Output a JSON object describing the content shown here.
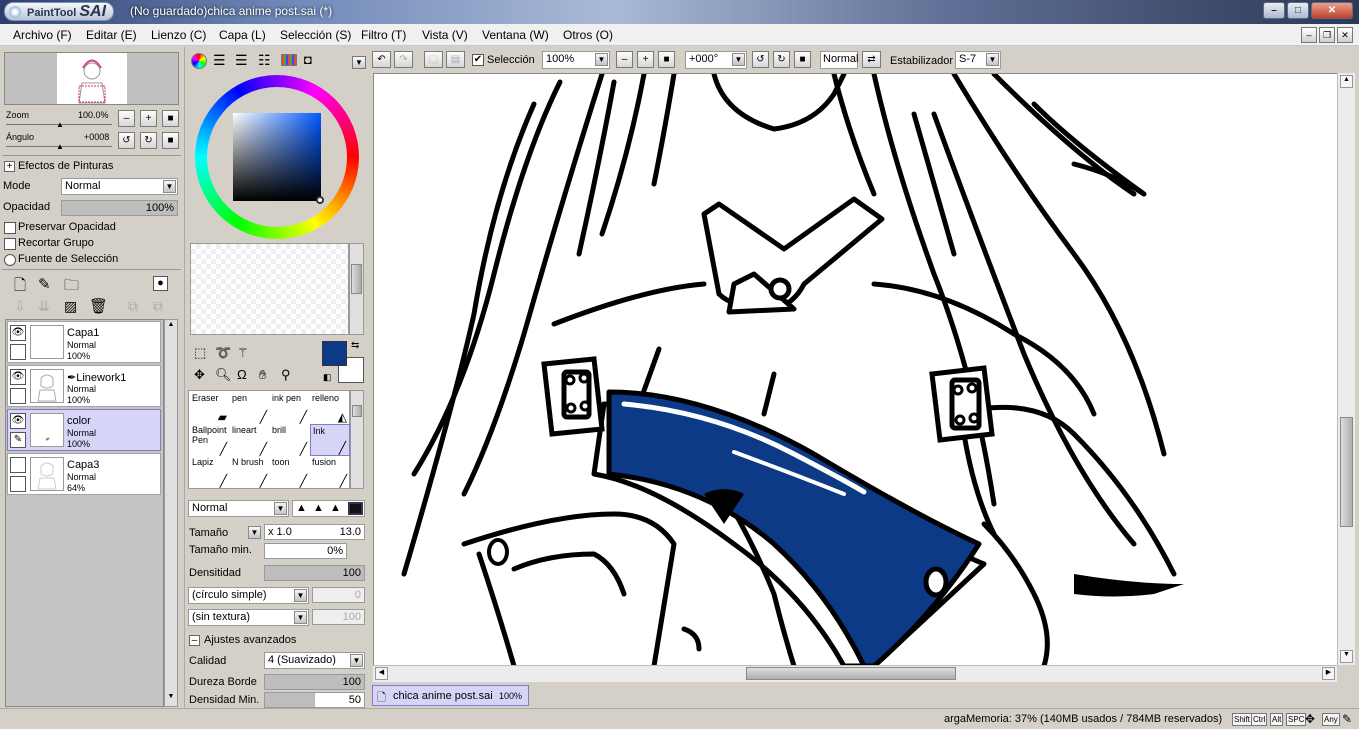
{
  "window": {
    "app_logo_small": "PaintTool",
    "app_logo_big": "SAI",
    "title": "(No guardado)chica anime post.sai (*)"
  },
  "menu": [
    "Archivo (F)",
    "Editar (E)",
    "Lienzo (C)",
    "Capa (L)",
    "Selección (S)",
    "Filtro (T)",
    "Vista (V)",
    "Ventana (W)",
    "Otros (O)"
  ],
  "navigator": {
    "zoom_label": "Zoom",
    "zoom_value": "100.0%",
    "angle_label": "Ángulo",
    "angle_value": "+0008"
  },
  "paint_effects": {
    "header": "Efectos de Pinturas",
    "mode_label": "Mode",
    "mode_value": "Normal",
    "opacity_label": "Opacidad",
    "opacity_value": "100%",
    "opacity_fraction": 1.0
  },
  "layer_options": {
    "preserve_opacity": "Preservar Opacidad",
    "clip_group": "Recortar Grupo",
    "selection_source": "Fuente de Selección"
  },
  "layers": [
    {
      "name": "Capa1",
      "mode": "Normal",
      "opacity": "100%",
      "selected": false
    },
    {
      "name": "Linework1",
      "mode": "Normal",
      "opacity": "100%",
      "selected": false
    },
    {
      "name": "color",
      "mode": "Normal",
      "opacity": "100%",
      "selected": true
    },
    {
      "name": "Capa3",
      "mode": "Normal",
      "opacity": "64%",
      "selected": false
    }
  ],
  "colors": {
    "primary": "#0c3a86",
    "secondary": "#ffffff",
    "accent_blue": "#0c3a86"
  },
  "brushes": [
    {
      "row": [
        "Eraser",
        "pen",
        "ink pen",
        "relleno"
      ]
    },
    {
      "row": [
        "Ballpoint Pen",
        "lineart",
        "brill",
        "Ink"
      ]
    },
    {
      "row": [
        "Lapiz",
        "N brush",
        "toon",
        "fusion"
      ]
    }
  ],
  "selected_brush": "Ink",
  "brush_settings": {
    "blend_mode": "Normal",
    "size_label": "Tamaño",
    "size_multiplier": "x 1.0",
    "size_value": "13.0",
    "min_size_label": "Tamaño min.",
    "min_size_value": "0%",
    "density_label": "Densitidad",
    "density_value": "100",
    "density_fraction": 1.0,
    "shape": "(círculo simple)",
    "shape_value": "0",
    "texture": "(sin textura)",
    "texture_value": "100",
    "advanced_header": "Ajustes avanzados",
    "quality_label": "Calidad",
    "quality_value": "4 (Suavizado)",
    "hardness_label": "Dureza Borde",
    "hardness_value": "100",
    "hardness_fraction": 1.0,
    "min_density_label": "Densidad Min.",
    "min_density_value": "50",
    "min_density_fraction": 0.5
  },
  "canvas_toolbar": {
    "selection_label": "Selección",
    "zoom_value": "100%",
    "rotation_value": "+000°",
    "mode_value": "Normal",
    "stabilizer_label": "Estabilizador",
    "stabilizer_value": "S-7"
  },
  "document_tab": {
    "name": "chica anime post.sai",
    "zoom": "100%"
  },
  "status": {
    "memory": "argaMemoria: 37% (140MB usados / 784MB reservados)",
    "keys": [
      "Shift",
      "Ctrl",
      "Alt",
      "SPC",
      "Any"
    ]
  }
}
